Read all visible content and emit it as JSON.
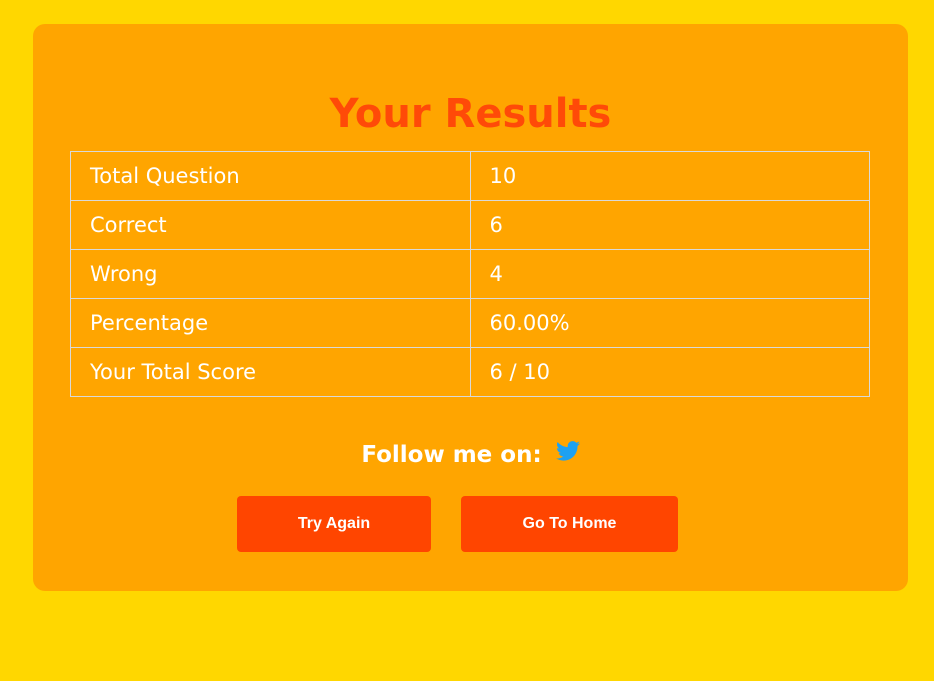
{
  "page": {
    "title": "Your Results"
  },
  "results": {
    "rows": [
      {
        "label": "Total Question",
        "value": "10"
      },
      {
        "label": "Correct",
        "value": "6"
      },
      {
        "label": "Wrong",
        "value": "4"
      },
      {
        "label": "Percentage",
        "value": "60.00%"
      },
      {
        "label": "Your Total Score",
        "value": "6 / 10"
      }
    ]
  },
  "social": {
    "follow_text": "Follow me on:",
    "icon": "twitter-icon",
    "icon_color": "#1da1f2"
  },
  "actions": {
    "try_again_label": "Try Again",
    "go_home_label": "Go To Home"
  },
  "colors": {
    "background": "#ffd700",
    "card": "#ffa500",
    "accent": "#ff4500",
    "title": "#ff4a08"
  }
}
